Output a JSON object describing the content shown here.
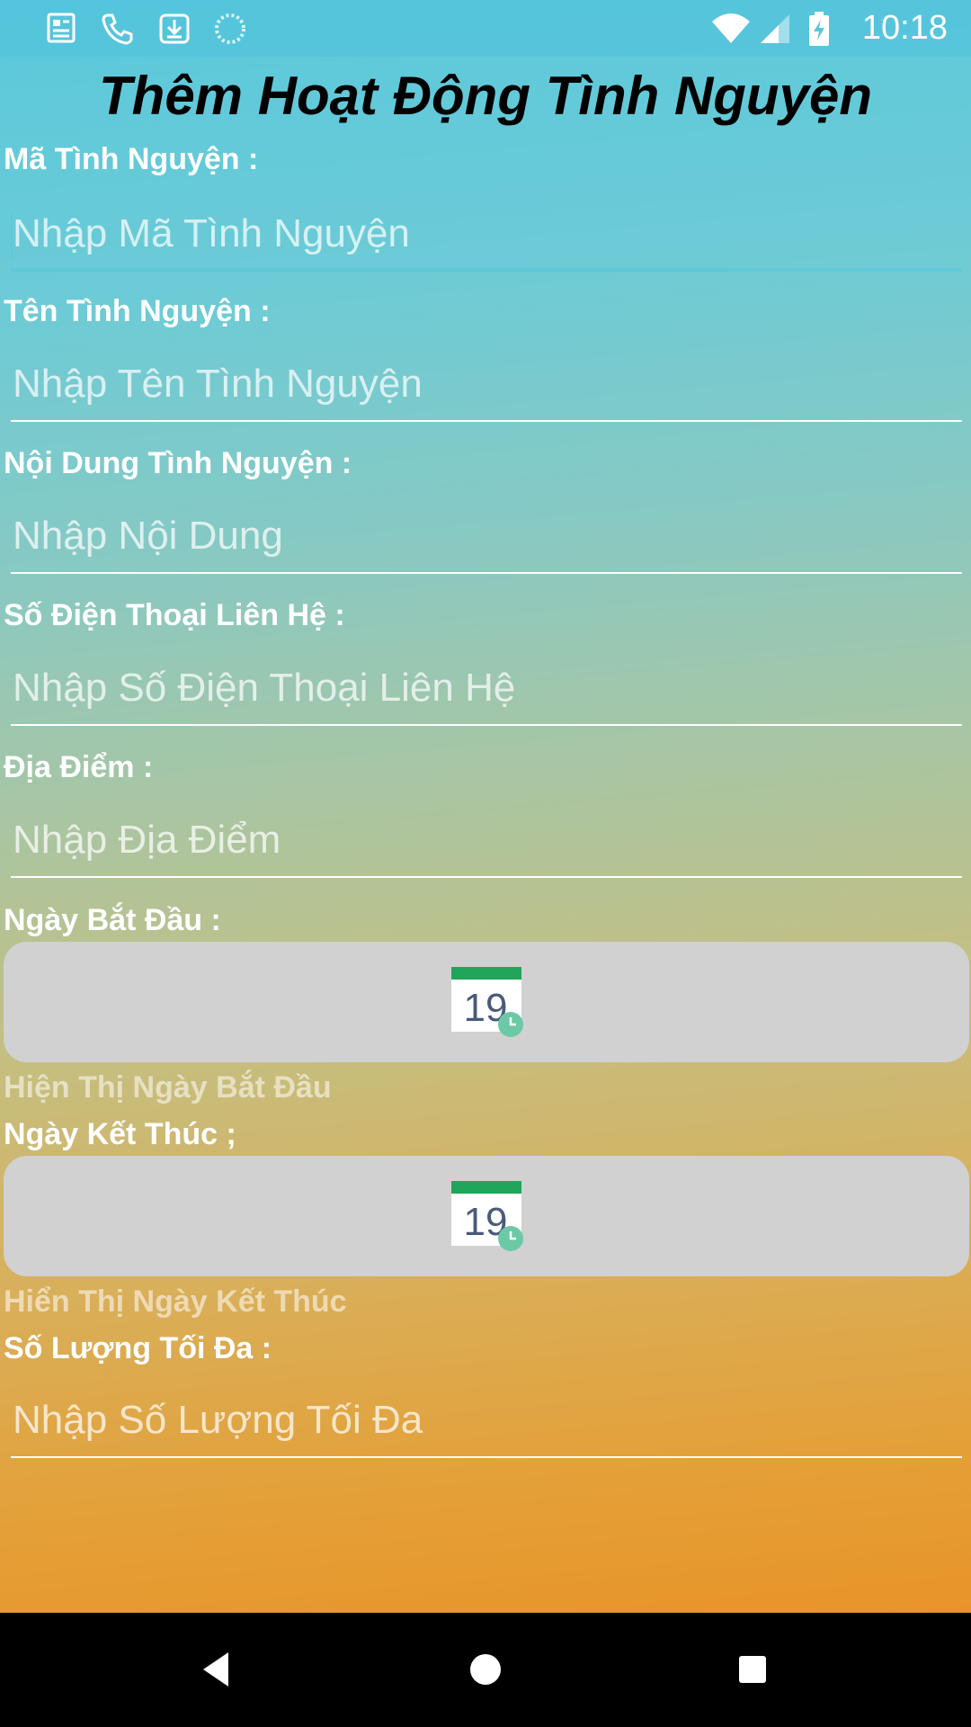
{
  "status_bar": {
    "time": "10:18",
    "left_icons": [
      "news-icon",
      "phone-icon",
      "download-icon",
      "loading-icon"
    ],
    "right_icons": [
      "wifi-icon",
      "signal-icon",
      "battery-charging-icon"
    ]
  },
  "page": {
    "title": "Thêm Hoạt Động Tình Nguyện"
  },
  "form": {
    "ma": {
      "label": "Mã Tình Nguyện :",
      "placeholder": "Nhập Mã Tình Nguyện",
      "value": ""
    },
    "ten": {
      "label": "Tên Tình Nguyện :",
      "placeholder": "Nhập Tên Tình Nguyện",
      "value": ""
    },
    "noi_dung": {
      "label": "Nội Dung Tình Nguyện :",
      "placeholder": "Nhập Nội Dung",
      "value": ""
    },
    "sdt": {
      "label": "Số Điện Thoại Liên Hệ :",
      "placeholder": "Nhập Số Điện Thoại Liên Hệ",
      "value": ""
    },
    "dia_diem": {
      "label": "Địa Điểm :",
      "placeholder": "Nhập Địa Điểm",
      "value": ""
    },
    "ngay_bat_dau": {
      "label": "Ngày Bắt Đầu :",
      "display": "Hiện Thị Ngày Bắt Đầu",
      "icon": "calendar-icon",
      "icon_day": "19"
    },
    "ngay_ket_thuc": {
      "label": "Ngày Kết Thúc ;",
      "display": "Hiển Thị Ngày Kết Thúc",
      "icon": "calendar-icon",
      "icon_day": "19"
    },
    "so_luong": {
      "label": "Số Lượng Tối Đa :",
      "placeholder": "Nhập Số Lượng Tối Đa",
      "value": ""
    }
  },
  "nav_bar": {
    "icons": [
      "back-icon",
      "home-icon",
      "recents-icon"
    ]
  },
  "colors": {
    "accent": "#5fc8d8",
    "date_button_bg": "#d1d1d1",
    "calendar_header": "#21a55a"
  }
}
